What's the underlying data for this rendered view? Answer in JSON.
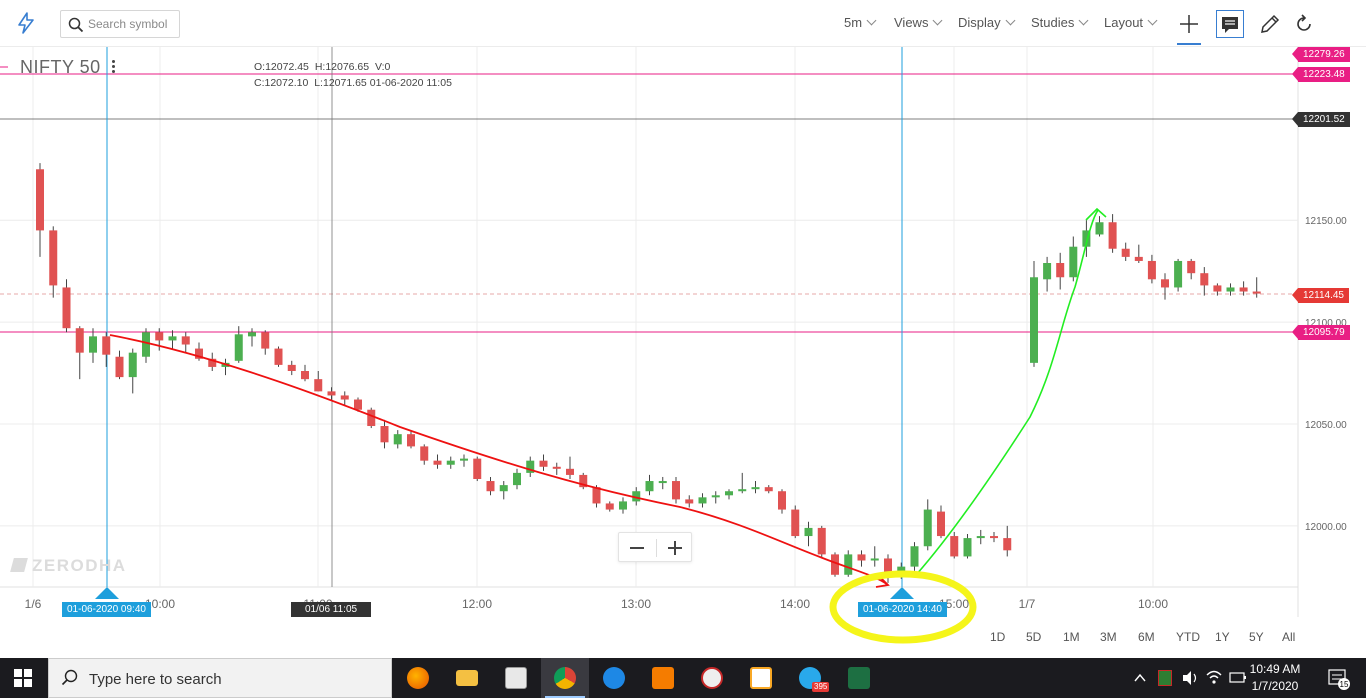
{
  "toolbar": {
    "search_placeholder": "Search symbol",
    "interval": "5m",
    "views": "Views",
    "display": "Display",
    "studies": "Studies",
    "layout": "Layout"
  },
  "legend": {
    "symbol": "NIFTY 50",
    "open": "O:12072.45",
    "high": "H:12076.65",
    "volume": "V:0",
    "close": "C:12072.10",
    "low": "L:12071.65",
    "datetime": "01-06-2020 11:05"
  },
  "watermark": "ZERODHA",
  "price_tags": {
    "top": "12279.26",
    "upper_line": "12223.48",
    "crosshair": "12201.52",
    "current": "12114.45",
    "lower_line": "12095.79"
  },
  "time_tags": {
    "left_line": "01-06-2020 09:40",
    "crosshair": "01/06 11:05",
    "right_line": "01-06-2020 14:40"
  },
  "periods": [
    "1D",
    "5D",
    "1M",
    "3M",
    "6M",
    "YTD",
    "1Y",
    "5Y",
    "All"
  ],
  "chart_data": {
    "type": "candlestick",
    "x_ticks": [
      "1/6",
      "10:00",
      "11:00",
      "12:00",
      "13:00",
      "14:00",
      "15:00",
      "1/7",
      "10:00"
    ],
    "y_ticks": [
      "12150.00",
      "12100.00",
      "12050.00",
      "12000.00"
    ],
    "ylim": [
      11970,
      12235
    ],
    "horizontal_lines": [
      12223.48,
      12201.52,
      12114.45,
      12095.79
    ],
    "colors": {
      "up": "#4caf50",
      "down": "#e05252",
      "pink": "#e91e84",
      "blue": "#1e9fdc",
      "grid": "#ececec"
    },
    "candles": [
      [
        12175,
        12178,
        12132,
        12145
      ],
      [
        12145,
        12147,
        12112,
        12118
      ],
      [
        12117,
        12121,
        12095,
        12097
      ],
      [
        12097,
        12098,
        12072,
        12085
      ],
      [
        12085,
        12097,
        12080,
        12093
      ],
      [
        12093,
        12095,
        12078,
        12084
      ],
      [
        12083,
        12086,
        12072,
        12073
      ],
      [
        12073,
        12087,
        12065,
        12085
      ],
      [
        12083,
        12097,
        12080,
        12095
      ],
      [
        12095,
        12097,
        12086,
        12091
      ],
      [
        12091,
        12096,
        12087,
        12093
      ],
      [
        12093,
        12095,
        12085,
        12089
      ],
      [
        12087,
        12090,
        12081,
        12082
      ],
      [
        12082,
        12085,
        12076,
        12078
      ],
      [
        12078,
        12082,
        12074,
        12080
      ],
      [
        12081,
        12098,
        12080,
        12094
      ],
      [
        12093,
        12097,
        12088,
        12095
      ],
      [
        12095,
        12096,
        12084,
        12087
      ],
      [
        12087,
        12088,
        12078,
        12079
      ],
      [
        12079,
        12081,
        12074,
        12076
      ],
      [
        12076,
        12079,
        12071,
        12072
      ],
      [
        12072,
        12076,
        12066,
        12066
      ],
      [
        12066,
        12068,
        12062,
        12064
      ],
      [
        12064,
        12066,
        12059,
        12062
      ],
      [
        12062,
        12063,
        12056,
        12057
      ],
      [
        12057,
        12058,
        12048,
        12049
      ],
      [
        12049,
        12052,
        12038,
        12041
      ],
      [
        12040,
        12047,
        12038,
        12045
      ],
      [
        12045,
        12047,
        12038,
        12039
      ],
      [
        12039,
        12040,
        12030,
        12032
      ],
      [
        12032,
        12035,
        12028,
        12030
      ],
      [
        12030,
        12034,
        12028,
        12032
      ],
      [
        12032,
        12035,
        12029,
        12033
      ],
      [
        12033,
        12034,
        12022,
        12023
      ],
      [
        12022,
        12024,
        12015,
        12017
      ],
      [
        12017,
        12022,
        12013,
        12020
      ],
      [
        12020,
        12028,
        12018,
        12026
      ],
      [
        12026,
        12034,
        12024,
        12032
      ],
      [
        12032,
        12035,
        12027,
        12029
      ],
      [
        12029,
        12031,
        12025,
        12028
      ],
      [
        12028,
        12034,
        12023,
        12025
      ],
      [
        12025,
        12026,
        12018,
        12019
      ],
      [
        12019,
        12020,
        12009,
        12011
      ],
      [
        12011,
        12012,
        12007,
        12008
      ],
      [
        12008,
        12014,
        12006,
        12012
      ],
      [
        12012,
        12019,
        12010,
        12017
      ],
      [
        12017,
        12025,
        12015,
        12022
      ],
      [
        12021,
        12024,
        12018,
        12022
      ],
      [
        12022,
        12024,
        12011,
        12013
      ],
      [
        12013,
        12015,
        12009,
        12011
      ],
      [
        12011,
        12016,
        12009,
        12014
      ],
      [
        12014,
        12017,
        12011,
        12015
      ],
      [
        12015,
        12018,
        12013,
        12017
      ],
      [
        12017,
        12026,
        12016,
        12018
      ],
      [
        12018,
        12022,
        12016,
        12019
      ],
      [
        12019,
        12020,
        12016,
        12017
      ],
      [
        12017,
        12018,
        12006,
        12008
      ],
      [
        12008,
        12010,
        11994,
        11995
      ],
      [
        11995,
        12002,
        11990,
        11999
      ],
      [
        11999,
        12000,
        11984,
        11986
      ],
      [
        11986,
        11987,
        11975,
        11976
      ],
      [
        11976,
        11988,
        11975,
        11986
      ],
      [
        11986,
        11988,
        11980,
        11983
      ],
      [
        11983,
        11990,
        11980,
        11984
      ],
      [
        11984,
        11986,
        11972,
        11976
      ],
      [
        11976,
        11982,
        11974,
        11980
      ],
      [
        11980,
        11992,
        11978,
        11990
      ],
      [
        11990,
        12013,
        11988,
        12008
      ],
      [
        12007,
        12010,
        11994,
        11995
      ],
      [
        11995,
        11997,
        11984,
        11985
      ],
      [
        11985,
        11996,
        11984,
        11994
      ],
      [
        11994,
        11998,
        11991,
        11995
      ],
      [
        11995,
        11997,
        11992,
        11994
      ],
      [
        11994,
        12000,
        11985,
        11988
      ],
      [
        12080,
        12130,
        12078,
        12122
      ],
      [
        12121,
        12132,
        12115,
        12129
      ],
      [
        12129,
        12134,
        12116,
        12122
      ],
      [
        12122,
        12142,
        12120,
        12137
      ],
      [
        12137,
        12150,
        12132,
        12145
      ],
      [
        12143,
        12152,
        12142,
        12149
      ],
      [
        12149,
        12153,
        12134,
        12136
      ],
      [
        12136,
        12139,
        12130,
        12132
      ],
      [
        12132,
        12138,
        12129,
        12130
      ],
      [
        12130,
        12133,
        12119,
        12121
      ],
      [
        12121,
        12124,
        12111,
        12117
      ],
      [
        12117,
        12131,
        12115,
        12130
      ],
      [
        12130,
        12131,
        12121,
        12124
      ],
      [
        12124,
        12127,
        12113,
        12118
      ],
      [
        12118,
        12119,
        12113,
        12115
      ],
      [
        12115,
        12119,
        12113,
        12117
      ],
      [
        12117,
        12120,
        12113,
        12115
      ],
      [
        12115,
        12122,
        12112,
        12114
      ]
    ]
  }
}
